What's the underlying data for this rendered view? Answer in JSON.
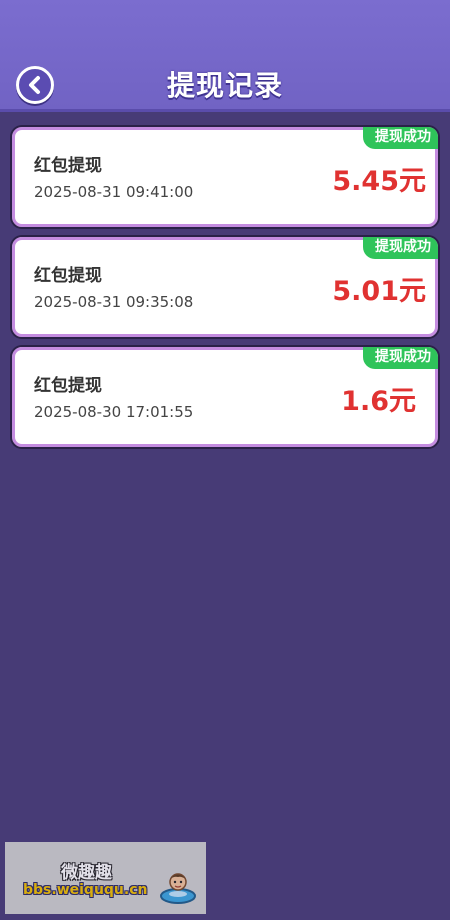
{
  "header": {
    "title": "提现记录",
    "back_icon": "chevron-left-icon"
  },
  "records": [
    {
      "title": "红包提现",
      "time": "2025-08-31 09:41:00",
      "amount": "5.45元",
      "status": "提现成功"
    },
    {
      "title": "红包提现",
      "time": "2025-08-31 09:35:08",
      "amount": "5.01元",
      "status": "提现成功"
    },
    {
      "title": "红包提现",
      "time": "2025-08-30 17:01:55",
      "amount": "1.6元",
      "status": "提现成功"
    }
  ],
  "watermark": {
    "title": "微趣趣",
    "url": "bbs.weiququ.cn",
    "mascot_icon": "swimming-mascot-icon"
  },
  "colors": {
    "header_bg": "#7b6dcf",
    "page_bg": "#473b76",
    "amount": "#e03231",
    "badge": "#2fc45a",
    "card_border": "#c48ce0"
  }
}
